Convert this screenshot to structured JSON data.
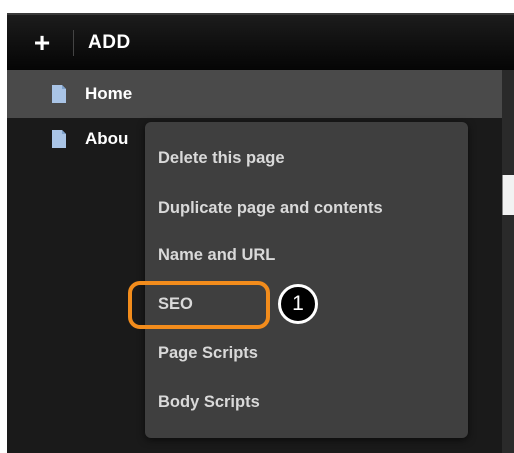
{
  "toolbar": {
    "add_icon": "plus-icon",
    "add_label": "ADD"
  },
  "pages": [
    {
      "label": "Home",
      "icon": "page-icon",
      "selected": true
    },
    {
      "label": "Abou",
      "icon": "page-icon",
      "selected": false
    }
  ],
  "context_menu": {
    "items": [
      {
        "label": "Delete this page"
      },
      {
        "label": "Duplicate page and contents"
      },
      {
        "label": "Name and URL"
      },
      {
        "label": "SEO",
        "highlighted": true
      },
      {
        "label": "Page Scripts"
      },
      {
        "label": "Body Scripts"
      }
    ]
  },
  "annotation": {
    "step_number": "1",
    "highlight_color": "#f28c1c"
  },
  "colors": {
    "panel_bg": "#1a1a1a",
    "selected_row_bg": "#4a4a4a",
    "menu_bg": "#3f3f3f",
    "menu_text": "#d9d9d9",
    "page_icon": "#a9c4e6"
  }
}
